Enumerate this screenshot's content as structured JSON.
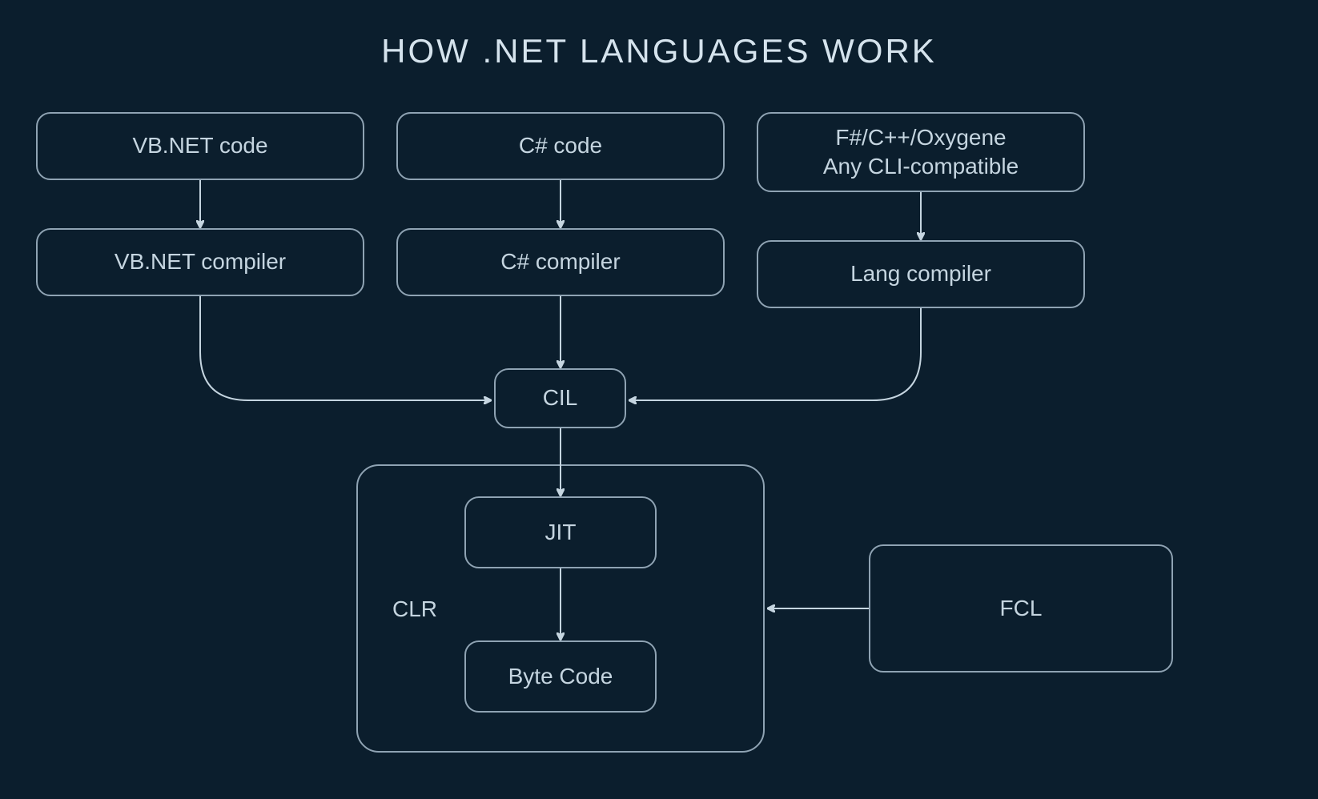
{
  "title": "HOW .NET LANGUAGES WORK",
  "nodes": {
    "vbnet_code": "VB.NET code",
    "csharp_code": "C# code",
    "other_code_line1": "F#/C++/Oxygene",
    "other_code_line2": "Any CLI-compatible",
    "vbnet_compiler": "VB.NET compiler",
    "csharp_compiler": "C# compiler",
    "lang_compiler": "Lang compiler",
    "cil": "CIL",
    "jit": "JIT",
    "byte_code": "Byte Code",
    "clr": "CLR",
    "fcl": "FCL"
  }
}
